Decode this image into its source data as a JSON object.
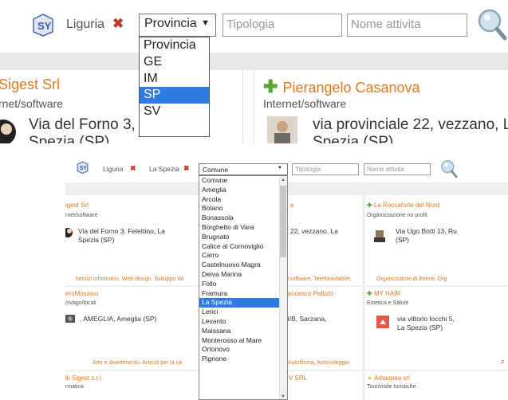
{
  "top_panel": {
    "region_label": "Liguria",
    "province_select_value": "Provincia",
    "province_options": [
      "Provincia",
      "GE",
      "IM",
      "SP",
      "SV"
    ],
    "province_selected": "SP",
    "tipologia_placeholder": "Tipologia",
    "nome_placeholder": "Nome attivita",
    "cards": [
      {
        "title": "Sigest Srl",
        "category": "rnet/software",
        "address1": "Via del Forno 3, Fel",
        "address2": "Spezia (SP)"
      },
      {
        "title": "Pierangelo Casanova",
        "category": "Internet/software",
        "address1": "via provinciale 22, vezzano, La",
        "address2": "Spezia (SP)"
      }
    ]
  },
  "bottom_panel": {
    "region_label": "Liguria",
    "province_label": "La Spezia",
    "comune_select_value": "Comune",
    "tipologia_placeholder": "Tipologia",
    "nome_placeholder": "Nome attivita",
    "comune_options": [
      "Comune",
      "Ameglia",
      "Arcola",
      "Bolano",
      "Bonassola",
      "Borghetto di Vara",
      "Brugnato",
      "Calice al Cornoviglio",
      "Carro",
      "Castelnuovo Magra",
      "Deiva Marina",
      "Follo",
      "Framura",
      "La Spezia",
      "Lerici",
      "Levanto",
      "Maissana",
      "Monterosso al Mare",
      "Ortonovo",
      "Pignone"
    ],
    "comune_selected": "La Spezia",
    "cards": [
      {
        "title": "igest Srl",
        "category": "rnet/software",
        "address": "Via del Forno 3, Felettino, La",
        "address2": "Spezia (SP)",
        "tags": "Servizi informatici, Web design, Sviluppo Wi"
      },
      {
        "title": "a",
        "category": "",
        "address": "22, vezzano, La",
        "address2": "",
        "tags": "/software, Telefono/tablet,"
      },
      {
        "title": "La Roccaforte del Nord",
        "category": "Organizzazione no profit",
        "address": "Via Ugo Botti 13, Ru",
        "address2": "(SP)",
        "tags": "Organizzatore di Eventi, Org"
      },
      {
        "title": "eroMosaico",
        "category": "/svago/locali",
        "address": ", AMEGLIA, Ameglia (SP)",
        "address2": "",
        "tags": "Arte e divertimento, Articoli per la ca"
      },
      {
        "title": "rancesco Pellistri",
        "category": "",
        "address": "3/B, Sarzana,",
        "address2": "",
        "tags": "Autofficina, Autonoleggio"
      },
      {
        "title": "MY HAIR",
        "category": "Estetica e Salute",
        "address": "via vittorio locchi 5,",
        "address2": "La Spezia (SP)",
        "tags": "P"
      },
      {
        "title": "lk Sigest s.r.l.",
        "category": "rmatica",
        "address": "",
        "address2": "",
        "tags": ""
      },
      {
        "title": "V SRL",
        "category": "",
        "address": "",
        "address2": "",
        "tags": ""
      },
      {
        "title": "Arbaspaa srl",
        "category": "Tour/visite turistiche",
        "address": "",
        "address2": "",
        "tags": ""
      }
    ]
  },
  "colors": {
    "accent_orange": "#e2791f",
    "remove_red": "#c0392b",
    "select_blue": "#2f7ce0",
    "plus_green": "#5aa832"
  }
}
